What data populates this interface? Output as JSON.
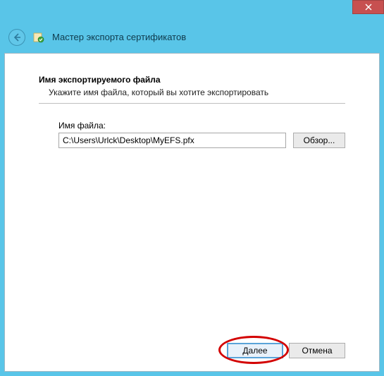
{
  "window": {
    "wizard_title": "Мастер экспорта сертификатов"
  },
  "section": {
    "heading": "Имя экспортируемого файла",
    "subtext": "Укажите имя файла, который вы хотите экспортировать"
  },
  "fields": {
    "filename_label": "Имя файла:",
    "filename_value": "C:\\Users\\Urlck\\Desktop\\MyEFS.pfx",
    "browse_label": "Обзор..."
  },
  "buttons": {
    "next": "Далее",
    "cancel": "Отмена"
  }
}
